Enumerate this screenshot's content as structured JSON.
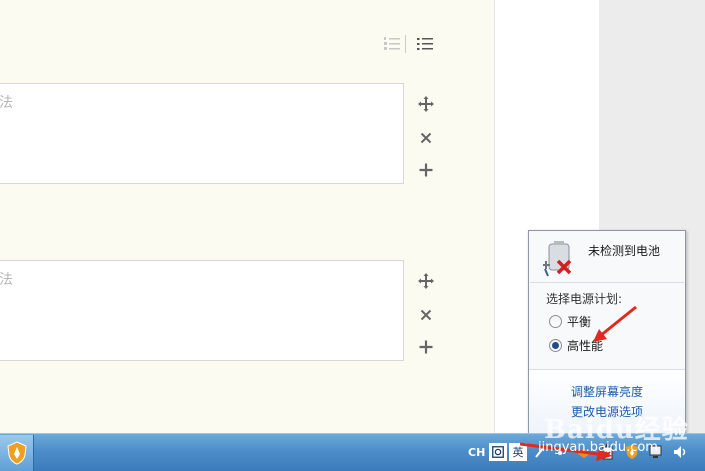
{
  "editor": {
    "textbox1": {
      "placeholder": "法"
    },
    "textbox2": {
      "placeholder": "法"
    }
  },
  "toolbar": {
    "icons": [
      "ordered-list-icon",
      "unordered-list-icon"
    ]
  },
  "row_tools": [
    "move-icon",
    "close-icon",
    "add-icon"
  ],
  "power_popup": {
    "battery_status": "未检测到电池",
    "plan_label": "选择电源计划:",
    "plans": [
      {
        "label": "平衡",
        "checked": false
      },
      {
        "label": "高性能",
        "checked": true
      }
    ],
    "links": [
      "调整屏幕亮度",
      "更改电源选项"
    ]
  },
  "taskbar": {
    "input_lang": "CH",
    "ime_label": "英"
  },
  "watermark": {
    "logo": "Baidu经验",
    "url": "jingyan.baidu.com"
  },
  "colors": {
    "editor_bg": "#fcfbf2",
    "taskbar": "#4c8ec9",
    "link": "#1e5ba8",
    "arrow": "#e02a20"
  }
}
